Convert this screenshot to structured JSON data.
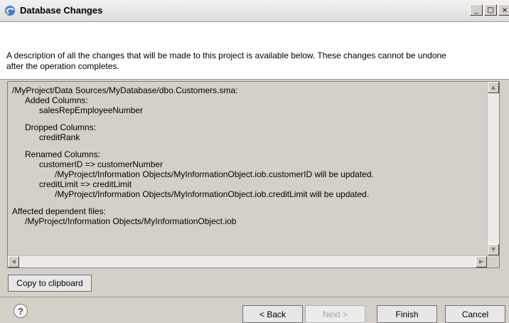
{
  "window": {
    "title": "Database Changes",
    "controls": {
      "minimize": "_",
      "maximize": "□",
      "close": "×"
    }
  },
  "banner": {
    "description": "A description of all the changes that will be made to this project is available below.  These changes cannot be undone after the operation completes."
  },
  "changes": {
    "lines": [
      {
        "level": 1,
        "text": "/MyProject/Data Sources/MyDatabase/dbo.Customers.sma:"
      },
      {
        "level": 2,
        "text": "Added Columns:"
      },
      {
        "level": 3,
        "text": "salesRepEmployeeNumber"
      },
      {
        "level": 0,
        "text": ""
      },
      {
        "level": 2,
        "text": "Dropped Columns:"
      },
      {
        "level": 3,
        "text": "creditRank"
      },
      {
        "level": 0,
        "text": ""
      },
      {
        "level": 2,
        "text": "Renamed Columns:"
      },
      {
        "level": 3,
        "text": "customerID => customerNumber"
      },
      {
        "level": 4,
        "text": "/MyProject/Information Objects/MyInformationObject.iob.customerID will be updated."
      },
      {
        "level": 3,
        "text": "creditLimit => creditLimit"
      },
      {
        "level": 4,
        "text": "/MyProject/Information Objects/MyInformationObject.iob.creditLimit will be updated."
      },
      {
        "level": 0,
        "text": ""
      },
      {
        "level": 1,
        "text": "Affected dependent files:"
      },
      {
        "level": 2,
        "text": "/MyProject/Information Objects/MyInformationObject.iob"
      }
    ]
  },
  "buttons": {
    "copy": "Copy to clipboard",
    "help": "?",
    "back": "< Back",
    "next": "Next >",
    "finish": "Finish",
    "cancel": "Cancel"
  },
  "colors": {
    "dialog_bg": "#d4d0c8",
    "banner_bg": "#ffffff",
    "title_icon": "#3a7fd8"
  }
}
